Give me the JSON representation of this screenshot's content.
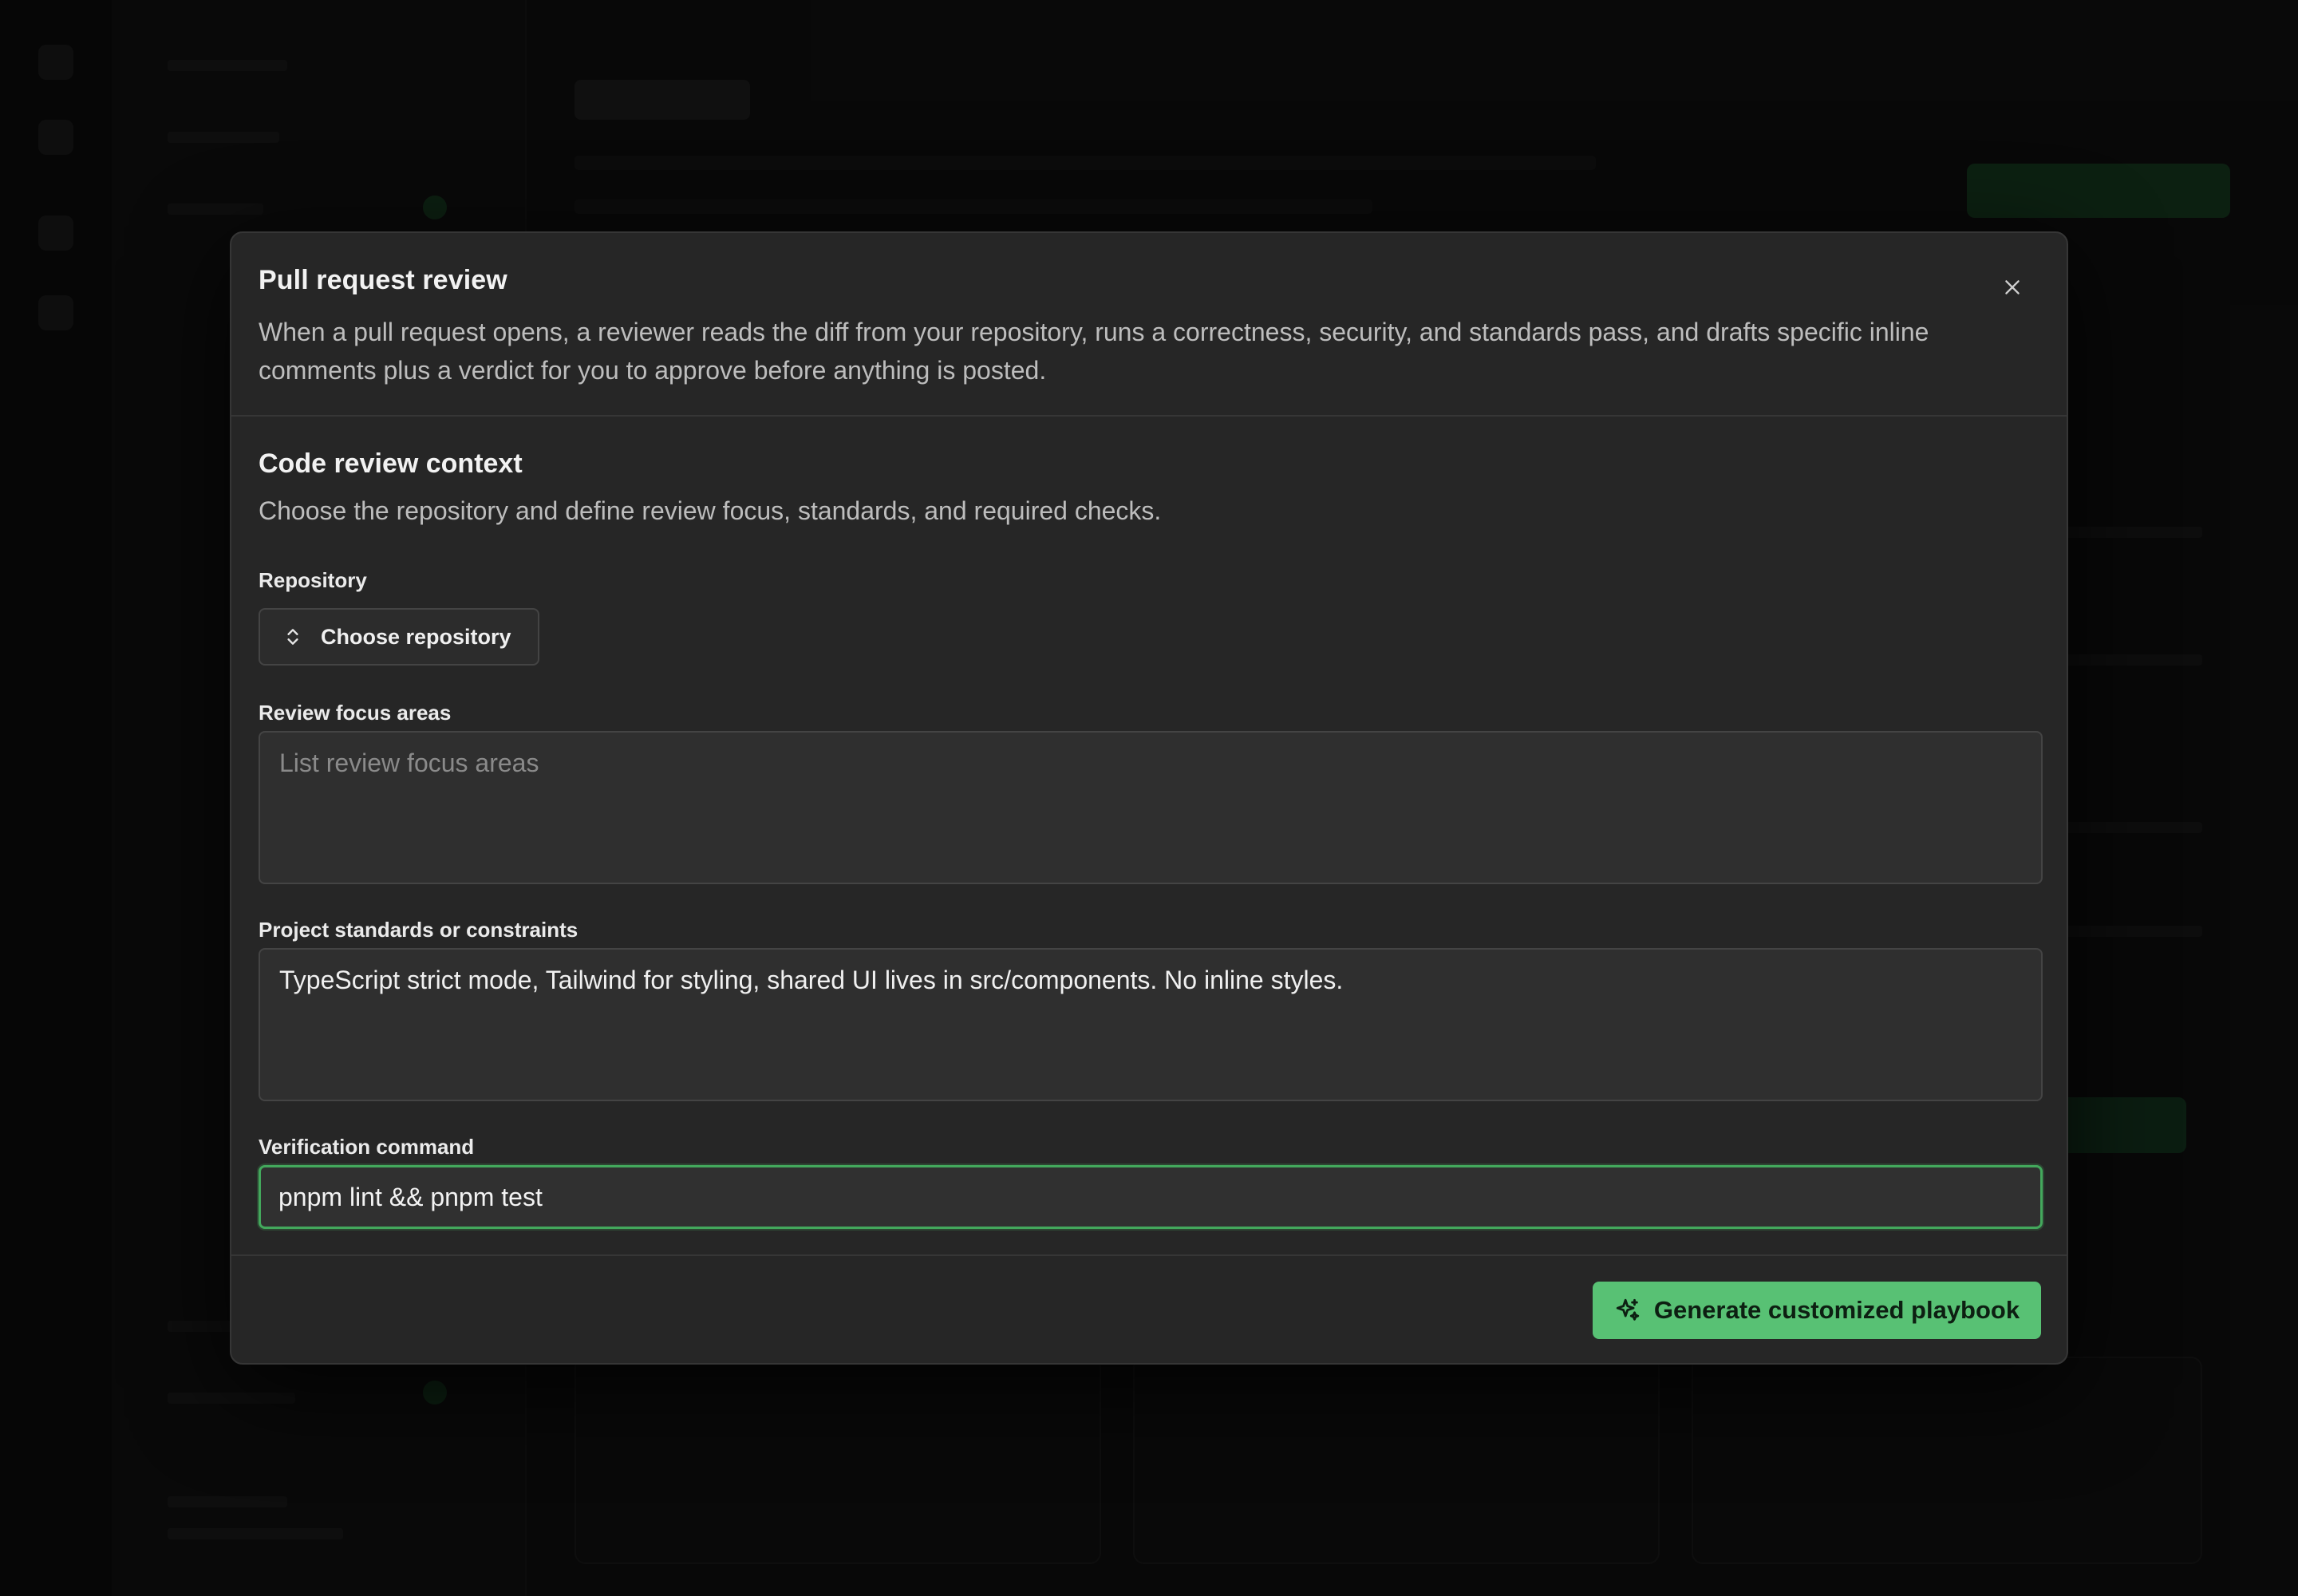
{
  "modal": {
    "title": "Pull request review",
    "description": "When a pull request opens, a reviewer reads the diff from your repository, runs a correctness, security, and standards pass, and drafts specific inline comments plus a verdict for you to approve before anything is posted.",
    "close_icon": "close-icon"
  },
  "section": {
    "title": "Code review context",
    "description": "Choose the repository and define review focus, standards, and required checks."
  },
  "fields": {
    "repository": {
      "label": "Repository",
      "button_label": "Choose repository",
      "icon": "chevron-up-down-icon"
    },
    "focus_areas": {
      "label": "Review focus areas",
      "value": "",
      "placeholder": "List review focus areas"
    },
    "standards": {
      "label": "Project standards or constraints",
      "value": "TypeScript strict mode, Tailwind for styling, shared UI lives in src/components. No inline styles.",
      "placeholder": ""
    },
    "verification": {
      "label": "Verification command",
      "value": "pnpm lint && pnpm test"
    }
  },
  "footer": {
    "generate_label": "Generate customized playbook",
    "generate_icon": "sparkles-icon"
  },
  "colors": {
    "accent": "#58c174",
    "focus_ring": "#43a85c",
    "modal_bg": "#262626"
  }
}
